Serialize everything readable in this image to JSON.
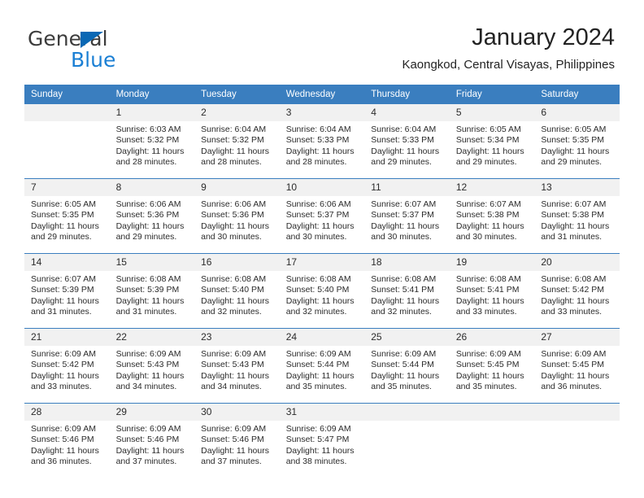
{
  "brand": {
    "name_part1": "General",
    "name_part2": "Blue",
    "triangle_color": "#0a68b4",
    "blue_color": "#1a7fd4"
  },
  "header": {
    "title": "January 2024",
    "location": "Kaongkod, Central Visayas, Philippines"
  },
  "theme": {
    "header_blue": "#3a7ebf",
    "day_band_gray": "#f1f1f1",
    "text": "#2b2b2b"
  },
  "weekdays": [
    "Sunday",
    "Monday",
    "Tuesday",
    "Wednesday",
    "Thursday",
    "Friday",
    "Saturday"
  ],
  "labels": {
    "sunrise_prefix": "Sunrise: ",
    "sunset_prefix": "Sunset: ",
    "daylight_prefix": "Daylight: "
  },
  "weeks": [
    {
      "days": [
        {
          "num": "",
          "sunrise": "",
          "sunset": "",
          "daylight": "",
          "empty": true
        },
        {
          "num": "1",
          "sunrise": "Sunrise: 6:03 AM",
          "sunset": "Sunset: 5:32 PM",
          "daylight": "Daylight: 11 hours and 28 minutes."
        },
        {
          "num": "2",
          "sunrise": "Sunrise: 6:04 AM",
          "sunset": "Sunset: 5:32 PM",
          "daylight": "Daylight: 11 hours and 28 minutes."
        },
        {
          "num": "3",
          "sunrise": "Sunrise: 6:04 AM",
          "sunset": "Sunset: 5:33 PM",
          "daylight": "Daylight: 11 hours and 28 minutes."
        },
        {
          "num": "4",
          "sunrise": "Sunrise: 6:04 AM",
          "sunset": "Sunset: 5:33 PM",
          "daylight": "Daylight: 11 hours and 29 minutes."
        },
        {
          "num": "5",
          "sunrise": "Sunrise: 6:05 AM",
          "sunset": "Sunset: 5:34 PM",
          "daylight": "Daylight: 11 hours and 29 minutes."
        },
        {
          "num": "6",
          "sunrise": "Sunrise: 6:05 AM",
          "sunset": "Sunset: 5:35 PM",
          "daylight": "Daylight: 11 hours and 29 minutes."
        }
      ]
    },
    {
      "days": [
        {
          "num": "7",
          "sunrise": "Sunrise: 6:05 AM",
          "sunset": "Sunset: 5:35 PM",
          "daylight": "Daylight: 11 hours and 29 minutes."
        },
        {
          "num": "8",
          "sunrise": "Sunrise: 6:06 AM",
          "sunset": "Sunset: 5:36 PM",
          "daylight": "Daylight: 11 hours and 29 minutes."
        },
        {
          "num": "9",
          "sunrise": "Sunrise: 6:06 AM",
          "sunset": "Sunset: 5:36 PM",
          "daylight": "Daylight: 11 hours and 30 minutes."
        },
        {
          "num": "10",
          "sunrise": "Sunrise: 6:06 AM",
          "sunset": "Sunset: 5:37 PM",
          "daylight": "Daylight: 11 hours and 30 minutes."
        },
        {
          "num": "11",
          "sunrise": "Sunrise: 6:07 AM",
          "sunset": "Sunset: 5:37 PM",
          "daylight": "Daylight: 11 hours and 30 minutes."
        },
        {
          "num": "12",
          "sunrise": "Sunrise: 6:07 AM",
          "sunset": "Sunset: 5:38 PM",
          "daylight": "Daylight: 11 hours and 30 minutes."
        },
        {
          "num": "13",
          "sunrise": "Sunrise: 6:07 AM",
          "sunset": "Sunset: 5:38 PM",
          "daylight": "Daylight: 11 hours and 31 minutes."
        }
      ]
    },
    {
      "days": [
        {
          "num": "14",
          "sunrise": "Sunrise: 6:07 AM",
          "sunset": "Sunset: 5:39 PM",
          "daylight": "Daylight: 11 hours and 31 minutes."
        },
        {
          "num": "15",
          "sunrise": "Sunrise: 6:08 AM",
          "sunset": "Sunset: 5:39 PM",
          "daylight": "Daylight: 11 hours and 31 minutes."
        },
        {
          "num": "16",
          "sunrise": "Sunrise: 6:08 AM",
          "sunset": "Sunset: 5:40 PM",
          "daylight": "Daylight: 11 hours and 32 minutes."
        },
        {
          "num": "17",
          "sunrise": "Sunrise: 6:08 AM",
          "sunset": "Sunset: 5:40 PM",
          "daylight": "Daylight: 11 hours and 32 minutes."
        },
        {
          "num": "18",
          "sunrise": "Sunrise: 6:08 AM",
          "sunset": "Sunset: 5:41 PM",
          "daylight": "Daylight: 11 hours and 32 minutes."
        },
        {
          "num": "19",
          "sunrise": "Sunrise: 6:08 AM",
          "sunset": "Sunset: 5:41 PM",
          "daylight": "Daylight: 11 hours and 33 minutes."
        },
        {
          "num": "20",
          "sunrise": "Sunrise: 6:08 AM",
          "sunset": "Sunset: 5:42 PM",
          "daylight": "Daylight: 11 hours and 33 minutes."
        }
      ]
    },
    {
      "days": [
        {
          "num": "21",
          "sunrise": "Sunrise: 6:09 AM",
          "sunset": "Sunset: 5:42 PM",
          "daylight": "Daylight: 11 hours and 33 minutes."
        },
        {
          "num": "22",
          "sunrise": "Sunrise: 6:09 AM",
          "sunset": "Sunset: 5:43 PM",
          "daylight": "Daylight: 11 hours and 34 minutes."
        },
        {
          "num": "23",
          "sunrise": "Sunrise: 6:09 AM",
          "sunset": "Sunset: 5:43 PM",
          "daylight": "Daylight: 11 hours and 34 minutes."
        },
        {
          "num": "24",
          "sunrise": "Sunrise: 6:09 AM",
          "sunset": "Sunset: 5:44 PM",
          "daylight": "Daylight: 11 hours and 35 minutes."
        },
        {
          "num": "25",
          "sunrise": "Sunrise: 6:09 AM",
          "sunset": "Sunset: 5:44 PM",
          "daylight": "Daylight: 11 hours and 35 minutes."
        },
        {
          "num": "26",
          "sunrise": "Sunrise: 6:09 AM",
          "sunset": "Sunset: 5:45 PM",
          "daylight": "Daylight: 11 hours and 35 minutes."
        },
        {
          "num": "27",
          "sunrise": "Sunrise: 6:09 AM",
          "sunset": "Sunset: 5:45 PM",
          "daylight": "Daylight: 11 hours and 36 minutes."
        }
      ]
    },
    {
      "days": [
        {
          "num": "28",
          "sunrise": "Sunrise: 6:09 AM",
          "sunset": "Sunset: 5:46 PM",
          "daylight": "Daylight: 11 hours and 36 minutes."
        },
        {
          "num": "29",
          "sunrise": "Sunrise: 6:09 AM",
          "sunset": "Sunset: 5:46 PM",
          "daylight": "Daylight: 11 hours and 37 minutes."
        },
        {
          "num": "30",
          "sunrise": "Sunrise: 6:09 AM",
          "sunset": "Sunset: 5:46 PM",
          "daylight": "Daylight: 11 hours and 37 minutes."
        },
        {
          "num": "31",
          "sunrise": "Sunrise: 6:09 AM",
          "sunset": "Sunset: 5:47 PM",
          "daylight": "Daylight: 11 hours and 38 minutes."
        },
        {
          "num": "",
          "sunrise": "",
          "sunset": "",
          "daylight": "",
          "empty": true
        },
        {
          "num": "",
          "sunrise": "",
          "sunset": "",
          "daylight": "",
          "empty": true
        },
        {
          "num": "",
          "sunrise": "",
          "sunset": "",
          "daylight": "",
          "empty": true
        }
      ]
    }
  ]
}
